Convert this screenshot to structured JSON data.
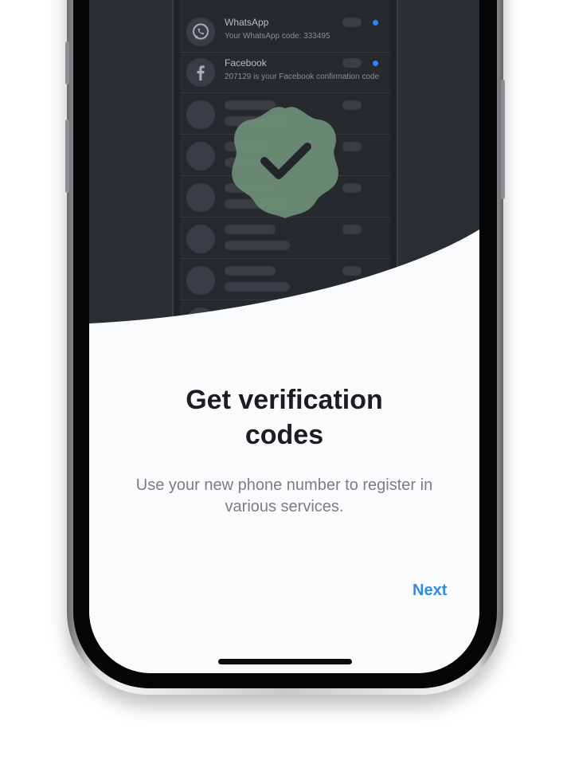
{
  "inner_list": {
    "items": [
      {
        "title": "WhatsApp",
        "text": "Your WhatsApp code: 333495",
        "icon": "whatsapp-icon"
      },
      {
        "title": "Facebook",
        "text": "207129 is your Facebook confirmation code",
        "icon": "facebook-icon"
      }
    ]
  },
  "onboarding": {
    "title_line1": "Get verification",
    "title_line2": "codes",
    "subtitle": "Use your new phone number to register in various services.",
    "next_label": "Next"
  },
  "colors": {
    "accent": "#2f8be6",
    "badge": "#6e8f78",
    "dark_background": "#2a2d32",
    "screen_background": "#fafbfd",
    "unread_dot": "#2f86f0"
  }
}
